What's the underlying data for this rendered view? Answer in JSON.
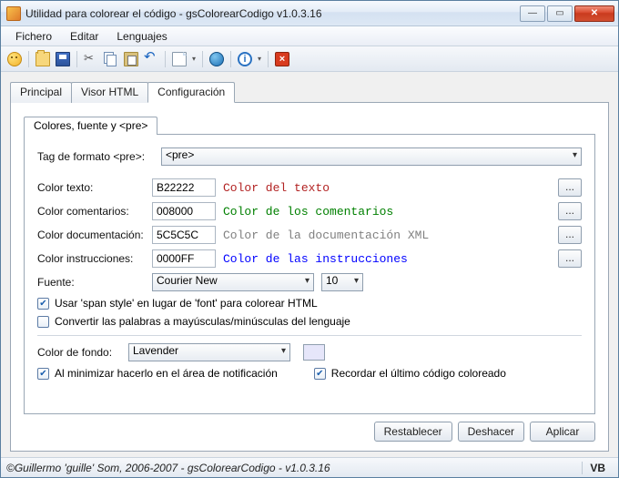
{
  "window": {
    "title": "Utilidad para colorear el código - gsColorearCodigo v1.0.3.16"
  },
  "menu": {
    "items": [
      "Fichero",
      "Editar",
      "Lenguajes"
    ]
  },
  "tabs": {
    "items": [
      "Principal",
      "Visor HTML",
      "Configuración"
    ],
    "active": 2
  },
  "inner_tab": {
    "label": "Colores, fuente y <pre>"
  },
  "config": {
    "tag_label": "Tag de formato <pre>:",
    "tag_value": "<pre>",
    "rows": [
      {
        "label": "Color texto:",
        "value": "B22222",
        "preview": "Color del texto",
        "color": "#B22222"
      },
      {
        "label": "Color comentarios:",
        "value": "008000",
        "preview": "Color de los comentarios",
        "color": "#008000"
      },
      {
        "label": "Color documentación:",
        "value": "5C5C5C",
        "preview": "Color de la documentación XML",
        "color": "#808080"
      },
      {
        "label": "Color instrucciones:",
        "value": "0000FF",
        "preview": "Color de las instrucciones",
        "color": "#0000FF"
      }
    ],
    "font_label": "Fuente:",
    "font_value": "Courier New",
    "font_size": "10",
    "chk_span": "Usar 'span style' en lugar de 'font' para colorear HTML",
    "chk_case": "Convertir las palabras a mayúsculas/minúsculas del lenguaje",
    "bg_label": "Color de fondo:",
    "bg_value": "Lavender",
    "bg_swatch": "#E6E6FA",
    "chk_tray": "Al minimizar hacerlo en el área de notificación",
    "chk_remember": "Recordar el último código coloreado",
    "chk_span_checked": true,
    "chk_case_checked": false,
    "chk_tray_checked": true,
    "chk_remember_checked": true
  },
  "buttons": {
    "reset": "Restablecer",
    "undo": "Deshacer",
    "apply": "Aplicar"
  },
  "status": {
    "text": "©Guillermo 'guille' Som, 2006-2007 - gsColorearCodigo - v1.0.3.16",
    "lang": "VB"
  }
}
